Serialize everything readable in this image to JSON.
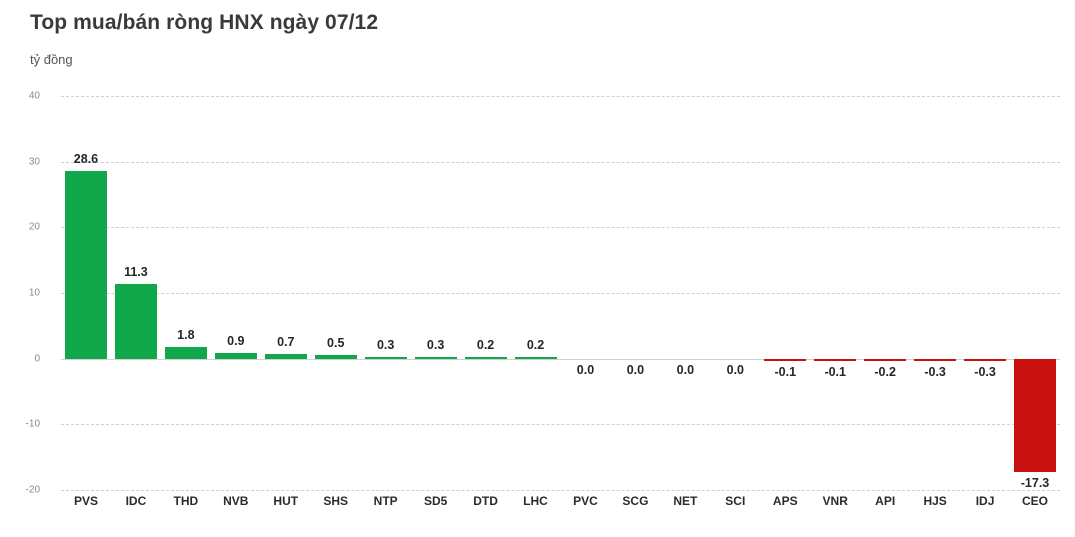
{
  "header": {
    "title": "Top mua/bán ròng HNX ngày 07/12",
    "unit": "tỷ đồng"
  },
  "colors": {
    "positive": "#10a74a",
    "negative": "#c8100f",
    "gridline": "#cfcfcf",
    "axis_text": "#8a8a8a",
    "label_text": "#262626"
  },
  "chart_data": {
    "type": "bar",
    "title": "Top mua/bán ròng HNX ngày 07/12",
    "xlabel": "",
    "ylabel": "tỷ đồng",
    "ylim": [
      -20,
      40
    ],
    "yticks": [
      40,
      30,
      20,
      10,
      0,
      -10,
      -20
    ],
    "ytick_labels": [
      "40",
      "30",
      "20",
      "10",
      "0",
      "-10",
      "-20"
    ],
    "grid": true,
    "legend": "none",
    "categories": [
      "PVS",
      "IDC",
      "THD",
      "NVB",
      "HUT",
      "SHS",
      "NTP",
      "SD5",
      "DTD",
      "LHC",
      "PVC",
      "SCG",
      "NET",
      "SCI",
      "APS",
      "VNR",
      "API",
      "HJS",
      "IDJ",
      "CEO"
    ],
    "values": [
      28.6,
      11.3,
      1.8,
      0.9,
      0.7,
      0.5,
      0.3,
      0.3,
      0.2,
      0.2,
      0.0,
      0.0,
      0.0,
      0.0,
      -0.1,
      -0.1,
      -0.2,
      -0.3,
      -0.3,
      -17.3
    ],
    "data_labels": [
      "28.6",
      "11.3",
      "1.8",
      "0.9",
      "0.7",
      "0.5",
      "0.3",
      "0.3",
      "0.2",
      "0.2",
      "0.0",
      "0.0",
      "0.0",
      "0.0",
      "-0.1",
      "-0.1",
      "-0.2",
      "-0.3",
      "-0.3",
      "-17.3"
    ]
  }
}
